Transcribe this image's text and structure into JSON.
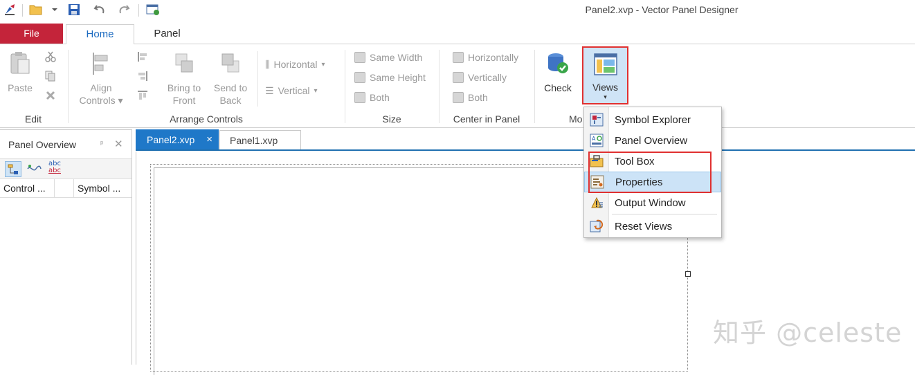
{
  "window": {
    "title": "Panel2.xvp - Vector Panel Designer"
  },
  "quick_access": [
    "app-icon",
    "open-folder-icon",
    "dropdown-arrow-icon",
    "save-icon",
    "undo-icon",
    "redo-icon",
    "window-icon"
  ],
  "ribbon_tabs": {
    "file": "File",
    "home": "Home",
    "panel": "Panel"
  },
  "ribbon": {
    "edit": {
      "label": "Edit",
      "paste": "Paste"
    },
    "arrange": {
      "label": "Arrange Controls",
      "align_line1": "Align",
      "align_line2": "Controls",
      "bring_line1": "Bring to",
      "bring_line2": "Front",
      "send_line1": "Send to",
      "send_line2": "Back",
      "horizontal": "Horizontal",
      "vertical": "Vertical"
    },
    "size": {
      "label": "Size",
      "same_width": "Same Width",
      "same_height": "Same Height",
      "both": "Both"
    },
    "center": {
      "label": "Center in Panel",
      "horizontally": "Horizontally",
      "vertically": "Vertically",
      "both": "Both"
    },
    "mode": {
      "label_partial": "Mo",
      "check": "Check",
      "views": "Views"
    }
  },
  "views_menu": {
    "items": [
      {
        "label": "Symbol Explorer",
        "icon": "symbol-explorer-icon"
      },
      {
        "label": "Panel Overview",
        "icon": "panel-overview-icon"
      },
      {
        "label": "Tool Box",
        "icon": "toolbox-icon"
      },
      {
        "label": "Properties",
        "icon": "properties-icon"
      },
      {
        "label": "Output Window",
        "icon": "output-window-icon"
      },
      {
        "label": "Reset Views",
        "icon": "reset-views-icon"
      }
    ]
  },
  "left_panel": {
    "title": "Panel Overview",
    "columns": [
      "Control ...",
      "Symbol ..."
    ],
    "toolbar_text_icon_top": "abc",
    "toolbar_text_icon_bottom": "abc"
  },
  "doc_tabs": [
    {
      "label": "Panel2.xvp",
      "active": true,
      "close": "×"
    },
    {
      "label": "Panel1.xvp",
      "active": false
    }
  ],
  "watermark": "知乎 @celeste",
  "colors": {
    "file_tab": "#c4243a",
    "accent": "#1f78c8",
    "highlight": "#e03030",
    "menu_hover": "#cce3f7"
  }
}
